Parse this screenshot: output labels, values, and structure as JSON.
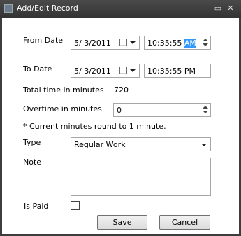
{
  "window": {
    "title": "Add/Edit Record",
    "minimize_glyph": "▭",
    "close_glyph": "✕"
  },
  "form": {
    "from_date": {
      "label": "From Date",
      "date": "5/  3/2011",
      "time_prefix": "10:35:55 ",
      "time_meridiem": "AM"
    },
    "to_date": {
      "label": "To Date",
      "date": "5/  3/2011",
      "time": "10:35:55 PM"
    },
    "total_time": {
      "label": "Total time in minutes",
      "value": "720"
    },
    "overtime": {
      "label": "Overtime in minutes",
      "value": "0"
    },
    "note_text": "* Current minutes round to 1 minute.",
    "type": {
      "label": "Type",
      "selected": "Regular Work"
    },
    "note": {
      "label": "Note",
      "value": ""
    },
    "is_paid": {
      "label": "Is Paid",
      "checked": false
    }
  },
  "buttons": {
    "save": "Save",
    "cancel": "Cancel"
  },
  "icons": {
    "calendar": "calendar-icon",
    "dropdown": "chevron-down-icon",
    "spin": "spin-updown-icon"
  }
}
